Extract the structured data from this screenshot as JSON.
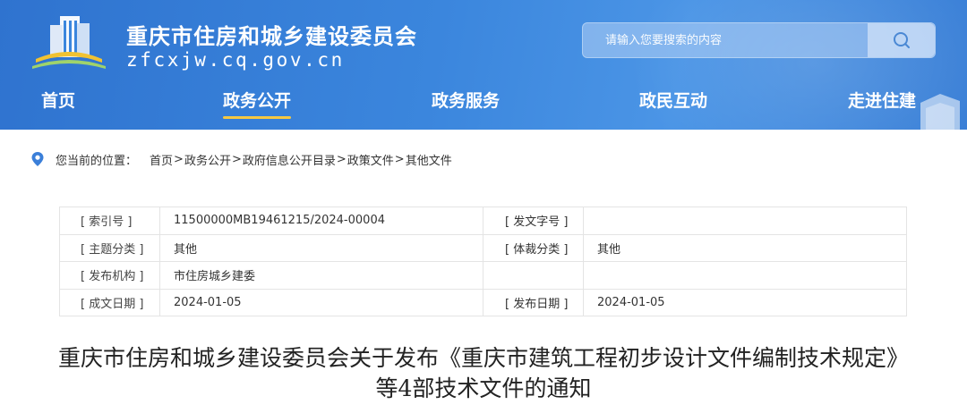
{
  "site": {
    "title": "重庆市住房和城乡建设委员会",
    "domain": "zfcxjw.cq.gov.cn"
  },
  "search": {
    "placeholder": "请输入您要搜索的内容",
    "button_icon": "search-icon"
  },
  "nav": {
    "items": [
      {
        "label": "首页"
      },
      {
        "label": "政务公开"
      },
      {
        "label": "政务服务"
      },
      {
        "label": "政民互动"
      },
      {
        "label": "走进住建"
      }
    ],
    "active": "政务公开"
  },
  "breadcrumb": {
    "icon": "location-pin-icon",
    "label": "您当前的位置：",
    "items": [
      "首页",
      "政务公开",
      "政府信息公开目录",
      "政策文件",
      "其他文件"
    ],
    "separator": ">"
  },
  "meta": {
    "rows": [
      {
        "k1": "[ 索引号 ]",
        "v1": "11500000MB19461215/2024-00004",
        "k2": "[ 发文字号 ]",
        "v2": ""
      },
      {
        "k1": "[ 主题分类 ]",
        "v1": "其他",
        "k2": "[ 体裁分类 ]",
        "v2": "其他"
      },
      {
        "k1": "[ 发布机构 ]",
        "v1": "市住房城乡建委",
        "k2": "",
        "v2": ""
      },
      {
        "k1": "[ 成文日期 ]",
        "v1": "2024-01-05",
        "k2": "[ 发布日期 ]",
        "v2": "2024-01-05"
      }
    ]
  },
  "document": {
    "title_line1": "重庆市住房和城乡建设委员会关于发布《重庆市建筑工程初步设计文件编制技术规定》",
    "title_line2": "等4部技术文件的通知"
  },
  "colors": {
    "header_blue": "#3b86dd",
    "nav_active_underline": "#f5c842"
  }
}
